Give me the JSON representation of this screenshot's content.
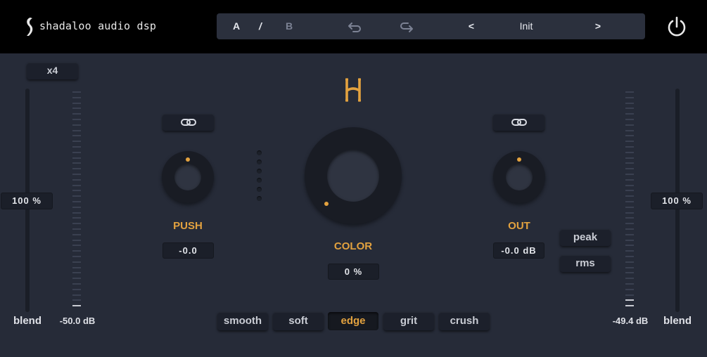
{
  "header": {
    "brand": "shadaloo audio dsp",
    "ab": {
      "a": "A",
      "sep": "/",
      "b": "B"
    },
    "undo_icon": "undo-arrow-icon",
    "redo_icon": "redo-arrow-icon",
    "prev": "<",
    "next": ">",
    "preset_name": "Init",
    "power_icon": "power-icon"
  },
  "left": {
    "oversample": "x4",
    "blend_value": "100 %",
    "blend_label": "blend",
    "meter_readout": "-50.0 dB"
  },
  "push": {
    "label": "PUSH",
    "value": "-0.0",
    "link_icon": "link-icon"
  },
  "color": {
    "logo_icon": "h-logo-icon",
    "label": "COLOR",
    "value": "0 %"
  },
  "out": {
    "label": "OUT",
    "value": "-0.0 dB",
    "link_icon": "link-icon"
  },
  "right": {
    "peak": "peak",
    "rms": "rms",
    "blend_value": "100 %",
    "blend_label": "blend",
    "meter_readout": "-49.4 dB"
  },
  "modes": [
    {
      "label": "smooth",
      "active": false
    },
    {
      "label": "soft",
      "active": false
    },
    {
      "label": "edge",
      "active": true
    },
    {
      "label": "grit",
      "active": false
    },
    {
      "label": "crush",
      "active": false
    }
  ],
  "colors": {
    "accent": "#e3a23f",
    "panel": "#262b38",
    "header": "#000000"
  }
}
